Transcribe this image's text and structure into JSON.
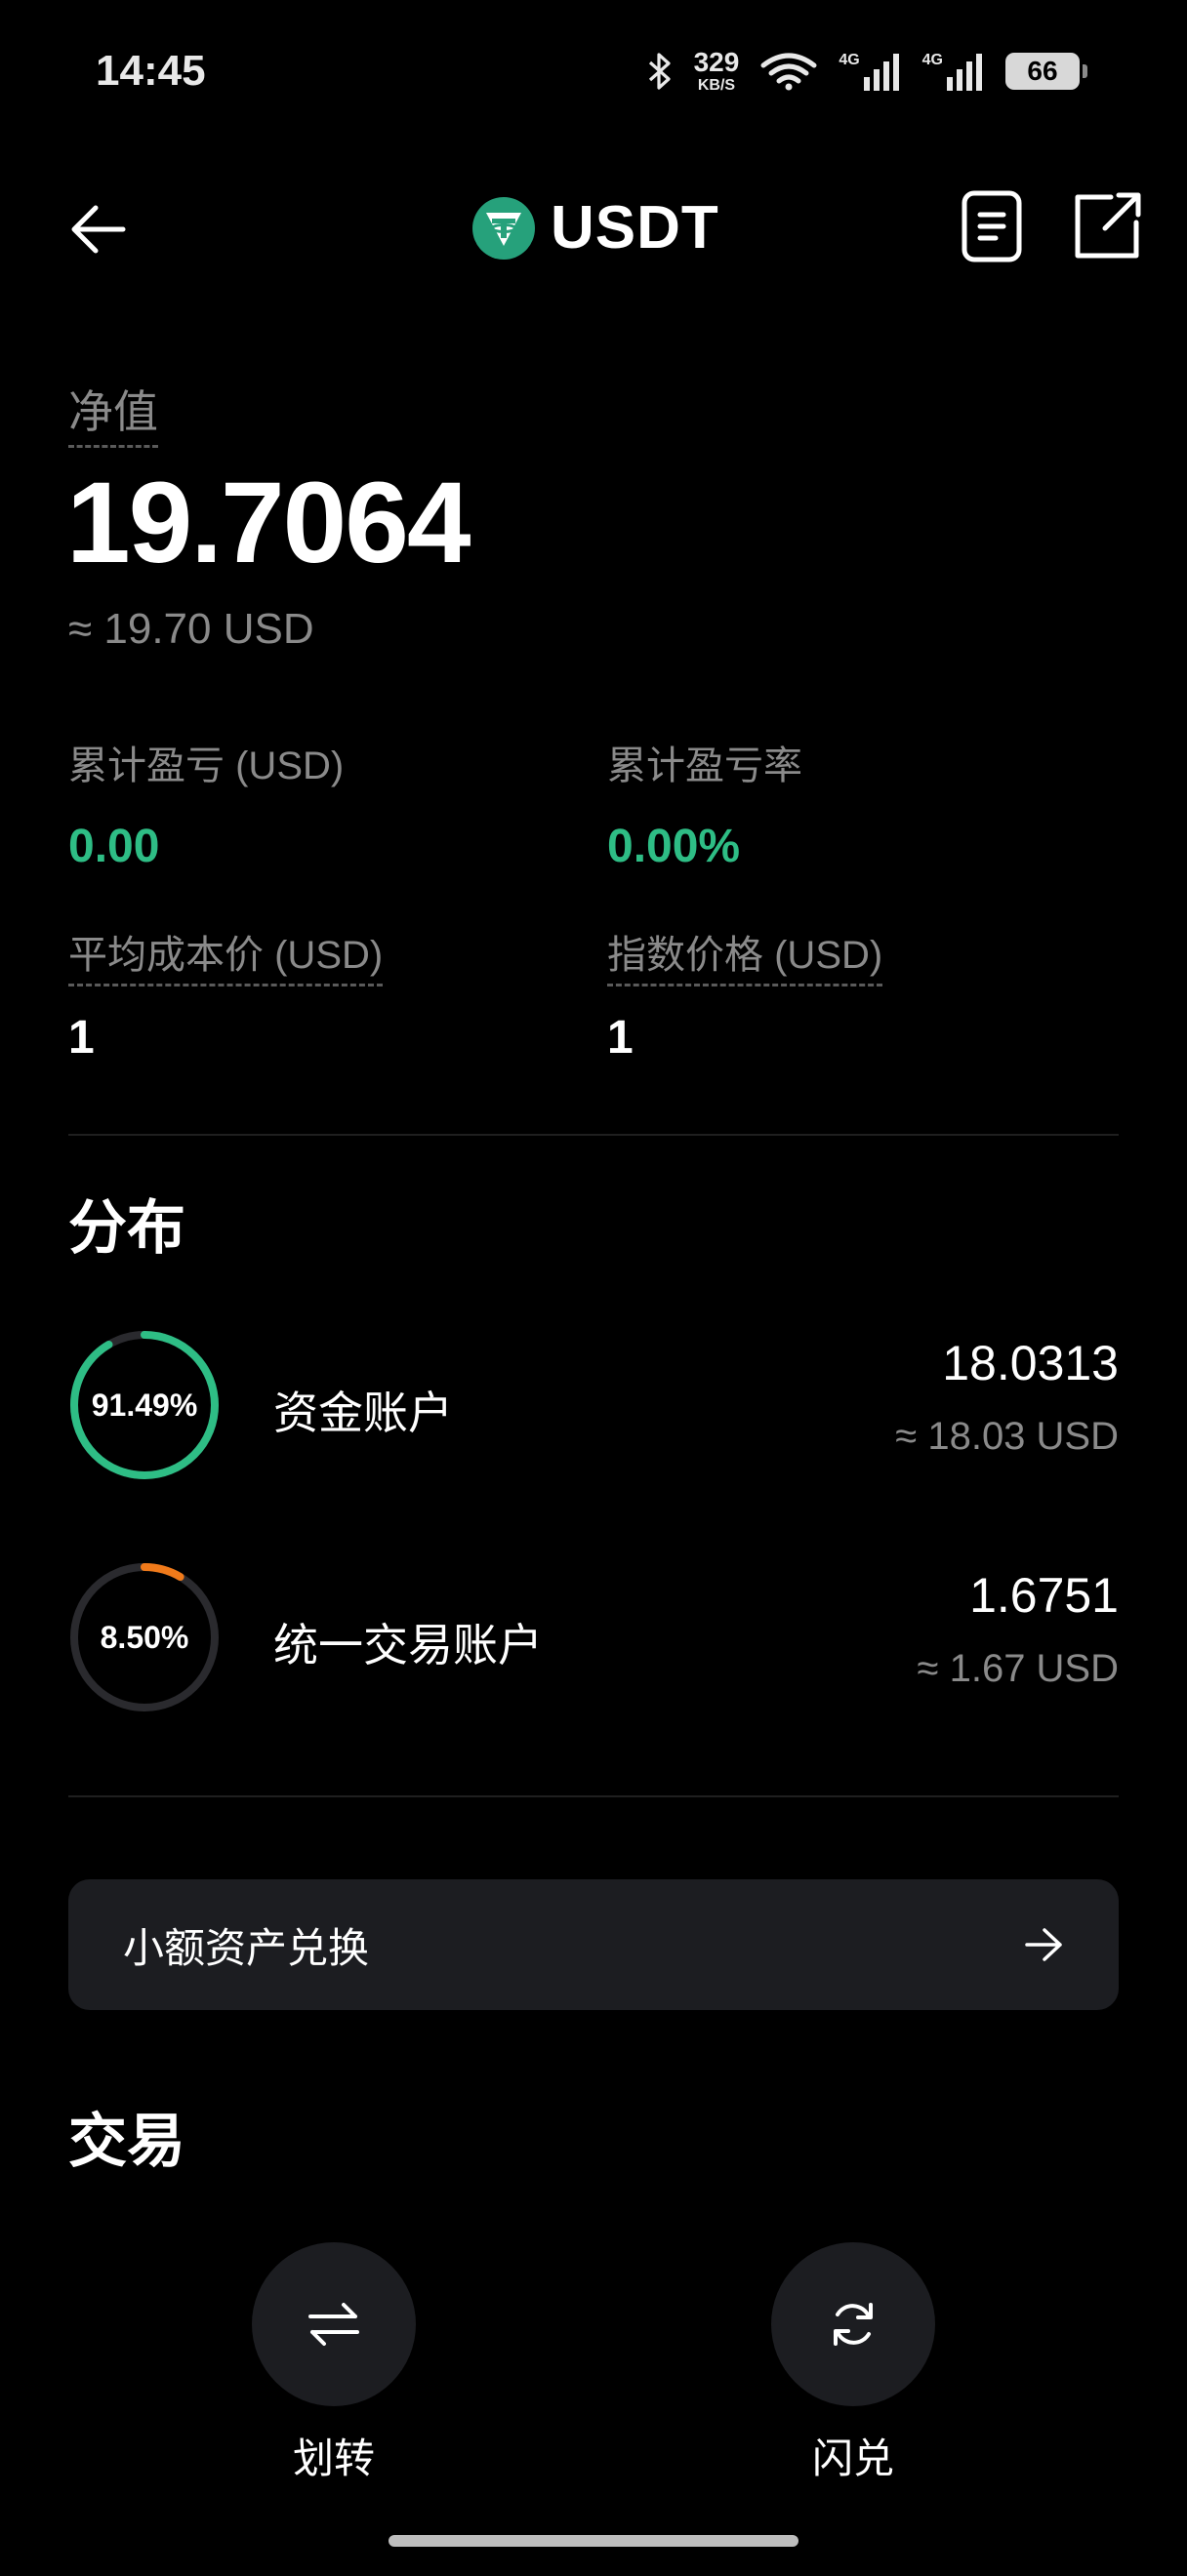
{
  "status_bar": {
    "time": "14:45",
    "net_speed_value": "329",
    "net_speed_unit": "KB/S",
    "signal_1_label": "4G",
    "signal_2_label": "4G",
    "battery": "66"
  },
  "header": {
    "title": "USDT",
    "back_icon": "arrow-left-icon",
    "doc_icon": "document-icon",
    "share_icon": "share-external-icon"
  },
  "summary": {
    "net_value_label": "净值",
    "net_value": "19.7064",
    "net_value_usd": "≈ 19.70 USD",
    "cum_pnl_label": "累计盈亏 (USD)",
    "cum_pnl_value": "0.00",
    "cum_pnl_rate_label": "累计盈亏率",
    "cum_pnl_rate_value": "0.00%",
    "avg_cost_label": "平均成本价 (USD)",
    "avg_cost_value": "1",
    "index_price_label": "指数价格 (USD)",
    "index_price_value": "1"
  },
  "distribution": {
    "title": "分布",
    "accounts": [
      {
        "percent_label": "91.49%",
        "percent": 0.9149,
        "color": "#2ebd85",
        "name": "资金账户",
        "amount": "18.0313",
        "usd": "≈ 18.03 USD"
      },
      {
        "percent_label": "8.50%",
        "percent": 0.085,
        "color": "#f07a1a",
        "name": "统一交易账户",
        "amount": "1.6751",
        "usd": "≈ 1.67 USD"
      }
    ]
  },
  "small_exchange": {
    "label": "小额资产兑换"
  },
  "trade": {
    "title": "交易",
    "buttons": [
      {
        "label": "划转",
        "icon": "transfer-arrows-icon"
      },
      {
        "label": "闪兑",
        "icon": "refresh-swap-icon"
      }
    ]
  },
  "colors": {
    "positive": "#2ebd85",
    "accent_orange": "#f07a1a",
    "card_bg": "#1c1d21"
  }
}
